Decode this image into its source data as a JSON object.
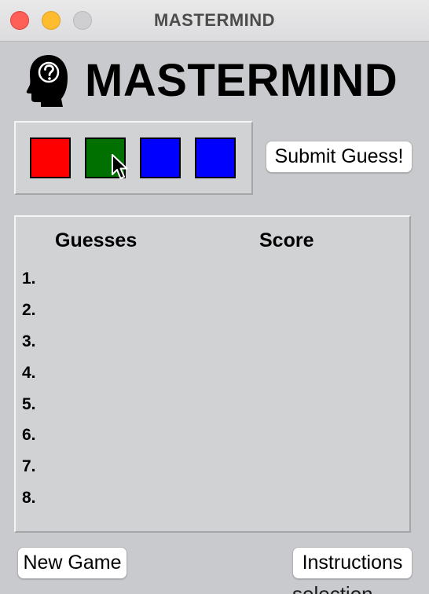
{
  "window": {
    "title": "MASTERMIND"
  },
  "header": {
    "app_title": "MASTERMIND",
    "logo_icon": "head-question-icon"
  },
  "guess": {
    "pegs": [
      {
        "color": "#ff0000"
      },
      {
        "color": "#007000"
      },
      {
        "color": "#0000ff"
      },
      {
        "color": "#0000ff"
      }
    ],
    "submit_label": "Submit Guess!"
  },
  "history": {
    "columns": [
      "Guesses",
      "Score"
    ],
    "rows": [
      "1.",
      "2.",
      "3.",
      "4.",
      "5.",
      "6.",
      "7.",
      "8."
    ]
  },
  "footer": {
    "new_game_label": "New Game",
    "instructions_label": "Instructions",
    "obscured_text": "selection"
  }
}
